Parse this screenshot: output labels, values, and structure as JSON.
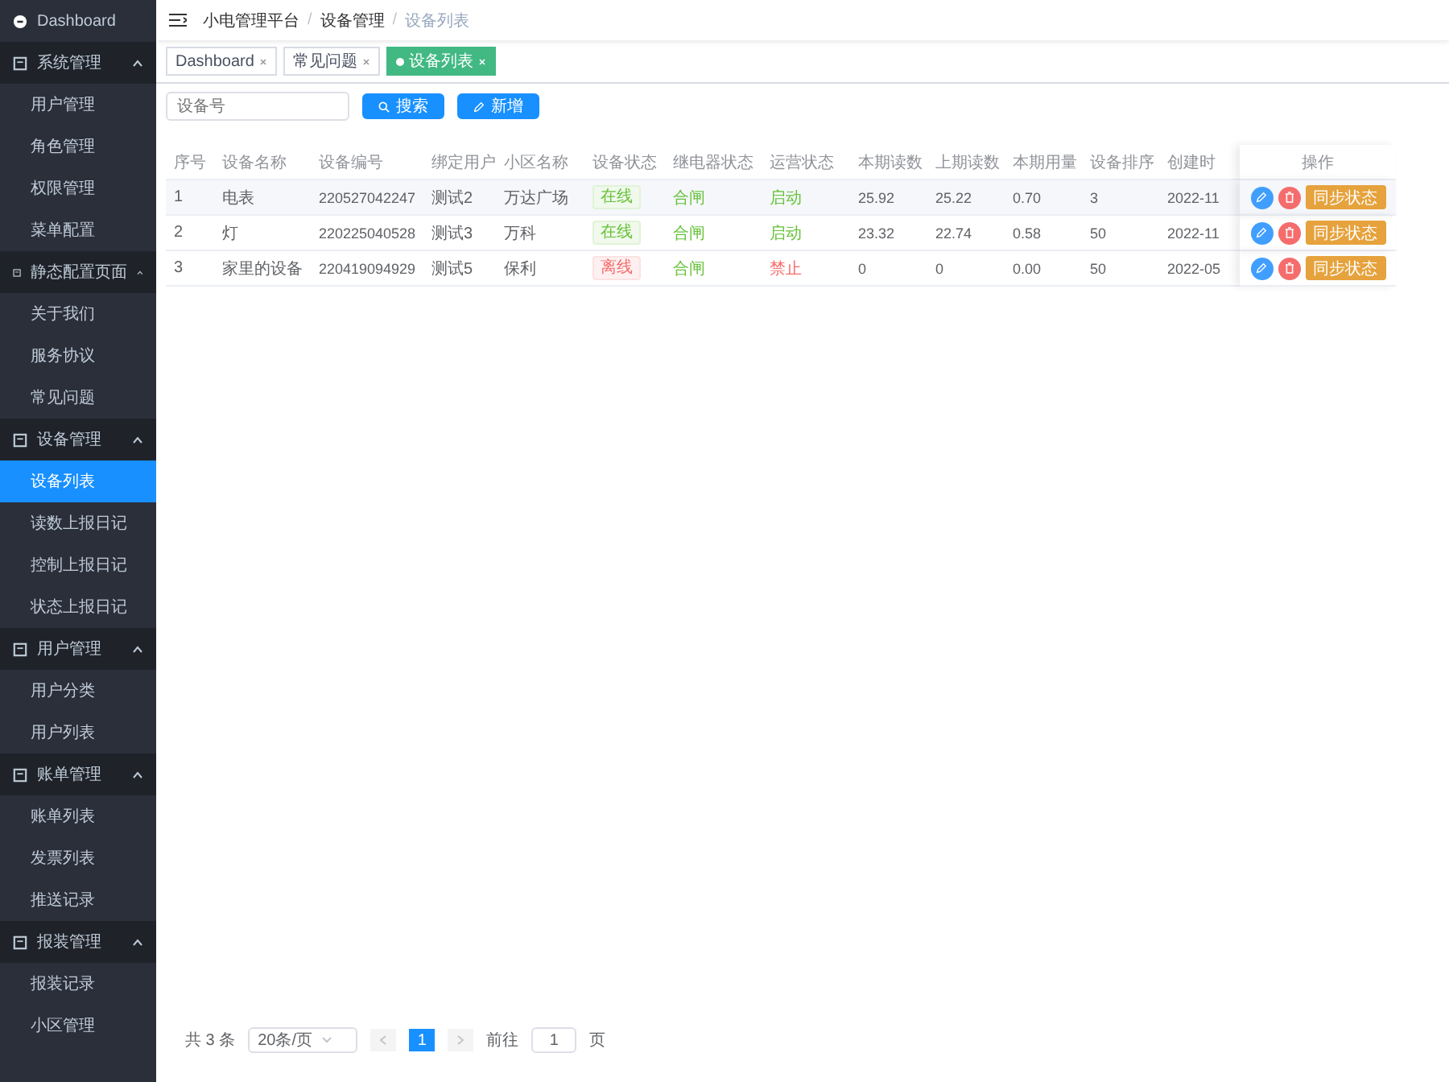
{
  "sidebar": {
    "items": [
      {
        "label": "Dashboard",
        "kind": "link"
      },
      {
        "label": "系统管理",
        "kind": "group",
        "expanded": true,
        "children": [
          {
            "label": "用户管理",
            "selected": false
          },
          {
            "label": "角色管理",
            "selected": false
          },
          {
            "label": "权限管理",
            "selected": false
          },
          {
            "label": "菜单配置",
            "selected": false
          }
        ]
      },
      {
        "label": "静态配置页面",
        "kind": "group",
        "expanded": true,
        "children": [
          {
            "label": "关于我们",
            "selected": false
          },
          {
            "label": "服务协议",
            "selected": false
          },
          {
            "label": "常见问题",
            "selected": false
          }
        ]
      },
      {
        "label": "设备管理",
        "kind": "group",
        "expanded": true,
        "children": [
          {
            "label": "设备列表",
            "selected": true
          },
          {
            "label": "读数上报日记",
            "selected": false
          },
          {
            "label": "控制上报日记",
            "selected": false
          },
          {
            "label": "状态上报日记",
            "selected": false
          }
        ]
      },
      {
        "label": "用户管理",
        "kind": "group",
        "expanded": true,
        "children": [
          {
            "label": "用户分类",
            "selected": false
          },
          {
            "label": "用户列表",
            "selected": false
          }
        ]
      },
      {
        "label": "账单管理",
        "kind": "group",
        "expanded": true,
        "children": [
          {
            "label": "账单列表",
            "selected": false
          },
          {
            "label": "发票列表",
            "selected": false
          },
          {
            "label": "推送记录",
            "selected": false
          }
        ]
      },
      {
        "label": "报装管理",
        "kind": "group",
        "expanded": true,
        "children": [
          {
            "label": "报装记录",
            "selected": false
          },
          {
            "label": "小区管理",
            "selected": false
          }
        ]
      }
    ]
  },
  "breadcrumb": {
    "separator": "/",
    "items": [
      "小电管理平台",
      "设备管理",
      "设备列表"
    ]
  },
  "tabs": [
    {
      "label": "Dashboard",
      "selected": false
    },
    {
      "label": "常见问题",
      "selected": false
    },
    {
      "label": "设备列表",
      "selected": true
    }
  ],
  "toolbar": {
    "search": {
      "placeholder": "设备号"
    },
    "buttons": [
      "搜索",
      "新增"
    ]
  },
  "table": {
    "columns": [
      "序号",
      "设备名称",
      "设备编号",
      "绑定用户",
      "小区名称",
      "设备状态",
      "继电器状态",
      "运营状态",
      "本期读数",
      "上期读数",
      "本期用量",
      "设备排序",
      "创建时",
      "操作"
    ],
    "rows": [
      {
        "index": "1",
        "name": "电表",
        "code": "220527042247",
        "user": "测试2",
        "community": "万达广场",
        "status": "在线",
        "online": true,
        "relay": "合闸",
        "relay_closed": true,
        "running": "启动",
        "enabled": true,
        "current": "25.92",
        "previous": "25.22",
        "usage": "0.70",
        "sort": "3",
        "created": "2022-11",
        "action": "同步状态"
      },
      {
        "index": "2",
        "name": "灯",
        "code": "220225040528",
        "user": "测试3",
        "community": "万科",
        "status": "在线",
        "online": true,
        "relay": "合闸",
        "relay_closed": true,
        "running": "启动",
        "enabled": true,
        "current": "23.32",
        "previous": "22.74",
        "usage": "0.58",
        "sort": "50",
        "created": "2022-11",
        "action": "同步状态"
      },
      {
        "index": "3",
        "name": "家里的设备",
        "code": "220419094929",
        "user": "测试5",
        "community": "保利",
        "status": "离线",
        "online": false,
        "relay": "合闸",
        "relay_closed": true,
        "running": "禁止",
        "enabled": false,
        "current": "0",
        "previous": "0",
        "usage": "0.00",
        "sort": "50",
        "created": "2022-05",
        "action": "同步状态"
      }
    ]
  },
  "pagination": {
    "total": "共 3 条",
    "page_size": "20条/页",
    "pages": [
      {
        "label": "1",
        "selected": true
      }
    ],
    "goto_label": "前往",
    "goto_value": "1",
    "goto_suffix": "页"
  }
}
